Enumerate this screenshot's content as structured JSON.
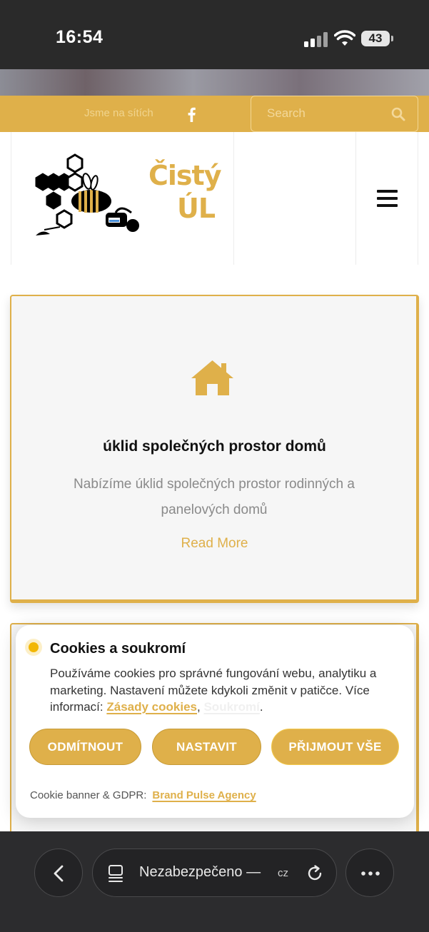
{
  "status_bar": {
    "time": "16:54",
    "battery": "43"
  },
  "top_bar": {
    "social_text": "Jsme na sítích",
    "social_icon": "facebook-icon",
    "search_placeholder": "Search"
  },
  "header": {
    "logo_line1": "Čistý",
    "logo_line2": "ÚL"
  },
  "service_card": {
    "icon": "home-icon",
    "title": "úklid společných prostor domů",
    "description": "Nabízíme úklid společných prostor rodinných a panelových domů",
    "link_label": "Read More"
  },
  "cookie_banner": {
    "title": "Cookies a soukromí",
    "text": "Používáme cookies pro správné fungování webu, analytiku a marketing. Nastavení můžete kdykoli změnit v patičce. Více informací:",
    "link_cookies": "Zásady cookies",
    "comma": ",",
    "link_privacy": "Soukromí",
    "period": ".",
    "btn_reject": "ODMÍTNOUT",
    "btn_settings": "NASTAVIT",
    "btn_accept": "PŘIJMOUT VŠE",
    "footer_text": "Cookie banner & GDPR:",
    "footer_link": "Brand Pulse Agency",
    "accent_color": "#dfb04a"
  },
  "browser": {
    "url_text": "Nezabezpečeno —",
    "url_suffix": "cz"
  }
}
